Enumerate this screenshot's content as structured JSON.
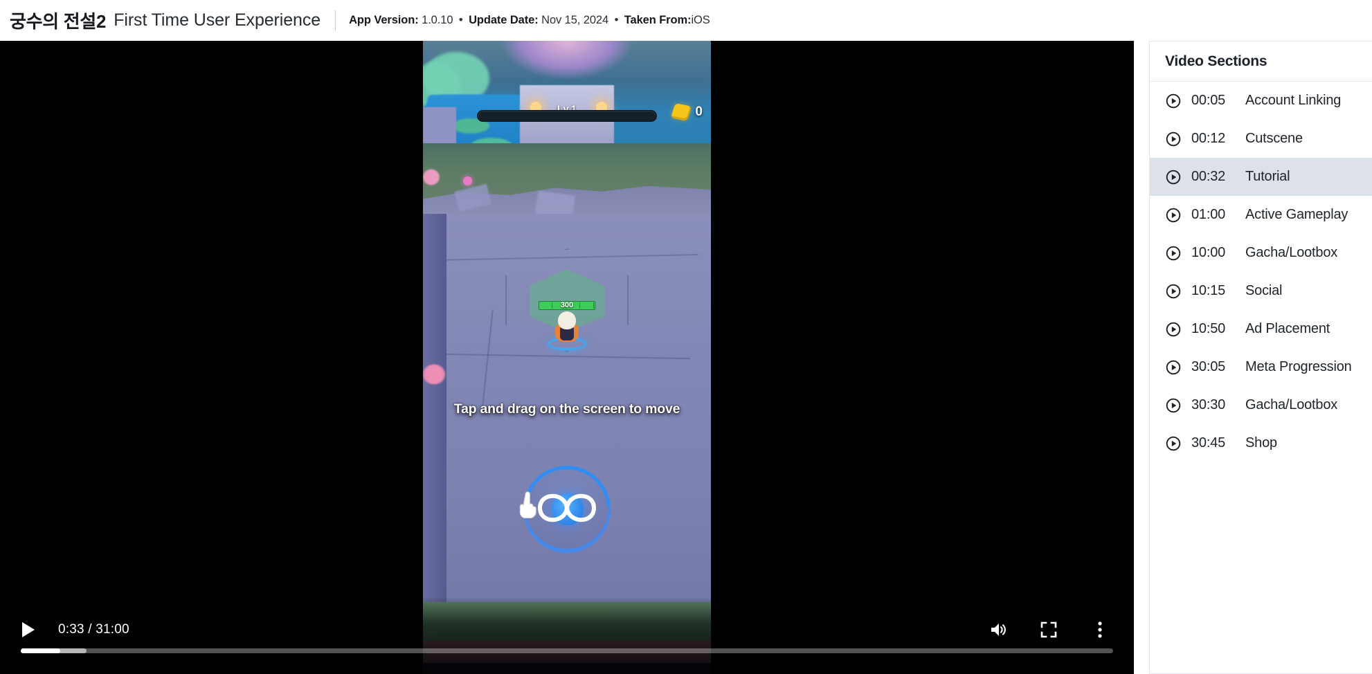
{
  "header": {
    "game_title": "궁수의 전설2",
    "subtitle": "First Time User Experience",
    "meta": {
      "app_version_label": "App Version:",
      "app_version_value": "1.0.10",
      "update_date_label": "Update Date:",
      "update_date_value": "Nov 15, 2024",
      "taken_from_label": "Taken From:",
      "taken_from_value": "iOS",
      "separator": "•"
    }
  },
  "video": {
    "current_time": "0:33",
    "duration": "31:00",
    "time_display": "0:33 / 31:00",
    "progress_percent": 3.6,
    "buffered_percent": 6.0,
    "play_button_label": "Play",
    "volume_button_label": "Mute",
    "fullscreen_button_label": "Full screen",
    "more_button_label": "More options",
    "overlay": {
      "level_label": "Lv.1",
      "coin_count": "0",
      "hero_hp": "300",
      "tutorial_text": "Tap and drag on the screen to move"
    }
  },
  "sidebar": {
    "title": "Video Sections",
    "active_index": 2,
    "items": [
      {
        "time": "00:05",
        "label": "Account Linking"
      },
      {
        "time": "00:12",
        "label": "Cutscene"
      },
      {
        "time": "00:32",
        "label": "Tutorial"
      },
      {
        "time": "01:00",
        "label": "Active Gameplay"
      },
      {
        "time": "10:00",
        "label": "Gacha/Lootbox"
      },
      {
        "time": "10:15",
        "label": "Social"
      },
      {
        "time": "10:50",
        "label": "Ad Placement"
      },
      {
        "time": "30:05",
        "label": "Meta Progression"
      },
      {
        "time": "30:30",
        "label": "Gacha/Lootbox"
      },
      {
        "time": "30:45",
        "label": "Shop"
      }
    ]
  },
  "colors": {
    "page_bg": "#ffffff",
    "text_primary": "#1b2029",
    "active_row": "#dde2e8",
    "border": "#e2e5ea",
    "video_bg": "#000000"
  }
}
